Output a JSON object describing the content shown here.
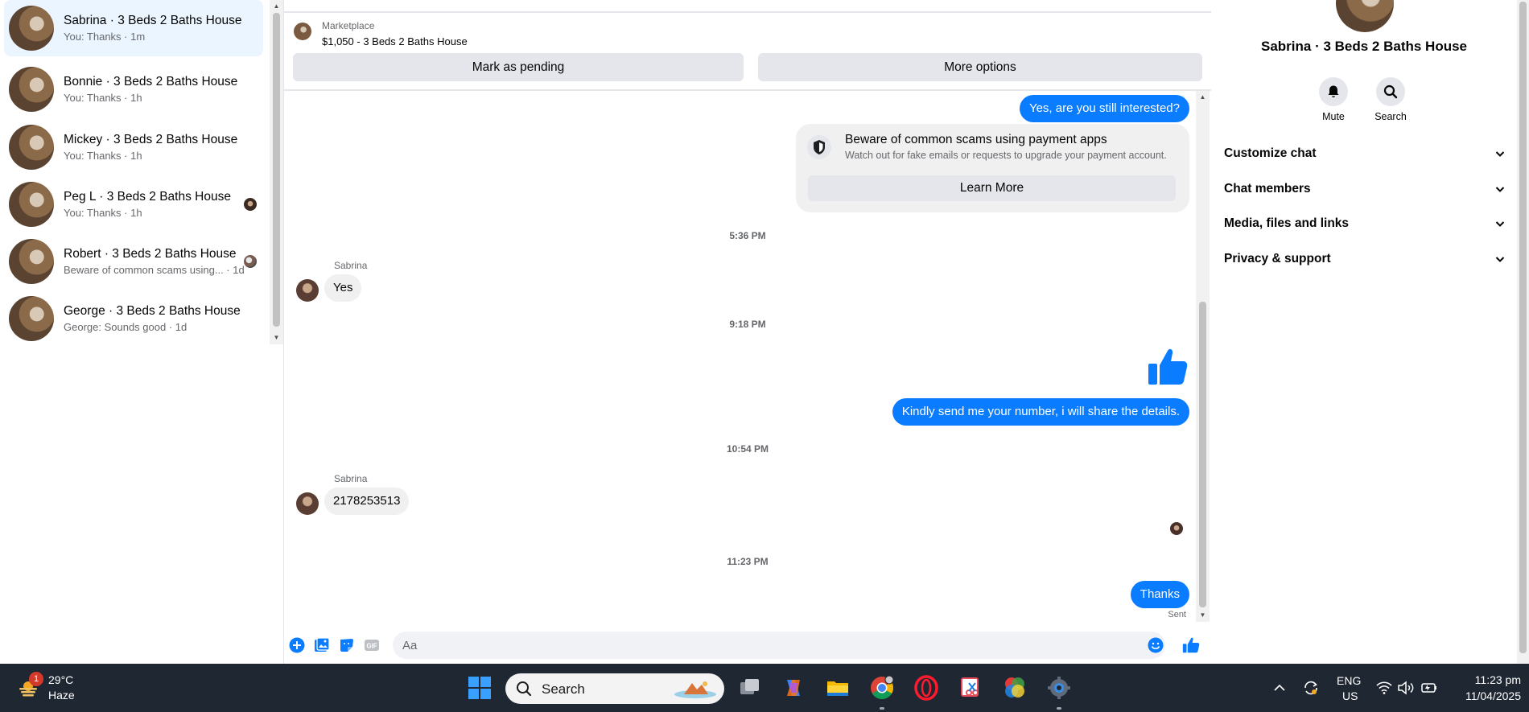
{
  "conversations": [
    {
      "name": "Sabrina · 3 Beds 2 Baths House",
      "preview": "You: Thanks · 1m",
      "active": true
    },
    {
      "name": "Bonnie · 3 Beds 2 Baths House",
      "preview": "You: Thanks · 1h"
    },
    {
      "name": "Mickey · 3 Beds 2 Baths House",
      "preview": "You: Thanks · 1h"
    },
    {
      "name": "Peg L · 3 Beds 2 Baths House",
      "preview": "You: Thanks · 1h"
    },
    {
      "name": "Robert · 3 Beds 2 Baths House",
      "preview": "Beware of common scams using... · 1d"
    },
    {
      "name": "George · 3 Beds 2 Baths House",
      "preview": "George: Sounds good · 1d"
    }
  ],
  "marketplace": {
    "source": "Marketplace",
    "title": "$1,050 - 3 Beds 2 Baths House",
    "mark_pending": "Mark as pending",
    "more_options": "More options"
  },
  "messages": {
    "out1": "Yes, are you still interested?",
    "scam_title": "Beware of common scams using payment apps",
    "scam_body": "Watch out for fake emails or requests to upgrade your payment account.",
    "scam_button": "Learn More",
    "time1": "5:36 PM",
    "sender1": "Sabrina",
    "in1": "Yes",
    "time2": "9:18 PM",
    "out2": "Kindly send me your number, i will share the details.",
    "time3": "10:54 PM",
    "sender2": "Sabrina",
    "in2": "2178253513",
    "time4": "11:23 PM",
    "out3": "Thanks",
    "status": "Sent"
  },
  "composer": {
    "placeholder": "Aa"
  },
  "details": {
    "name": "Sabrina · 3 Beds 2 Baths House",
    "mute": "Mute",
    "search": "Search",
    "sections": [
      "Customize chat",
      "Chat members",
      "Media, files and links",
      "Privacy & support"
    ]
  },
  "taskbar": {
    "weather_temp": "29°C",
    "weather_cond": "Haze",
    "weather_badge": "1",
    "search_placeholder": "Search",
    "lang1": "ENG",
    "lang2": "US",
    "time": "11:23 pm",
    "date": "11/04/2025"
  },
  "colors": {
    "accent": "#0a7cff",
    "taskbar": "#1f2733",
    "active_row": "#ebf5ff"
  }
}
